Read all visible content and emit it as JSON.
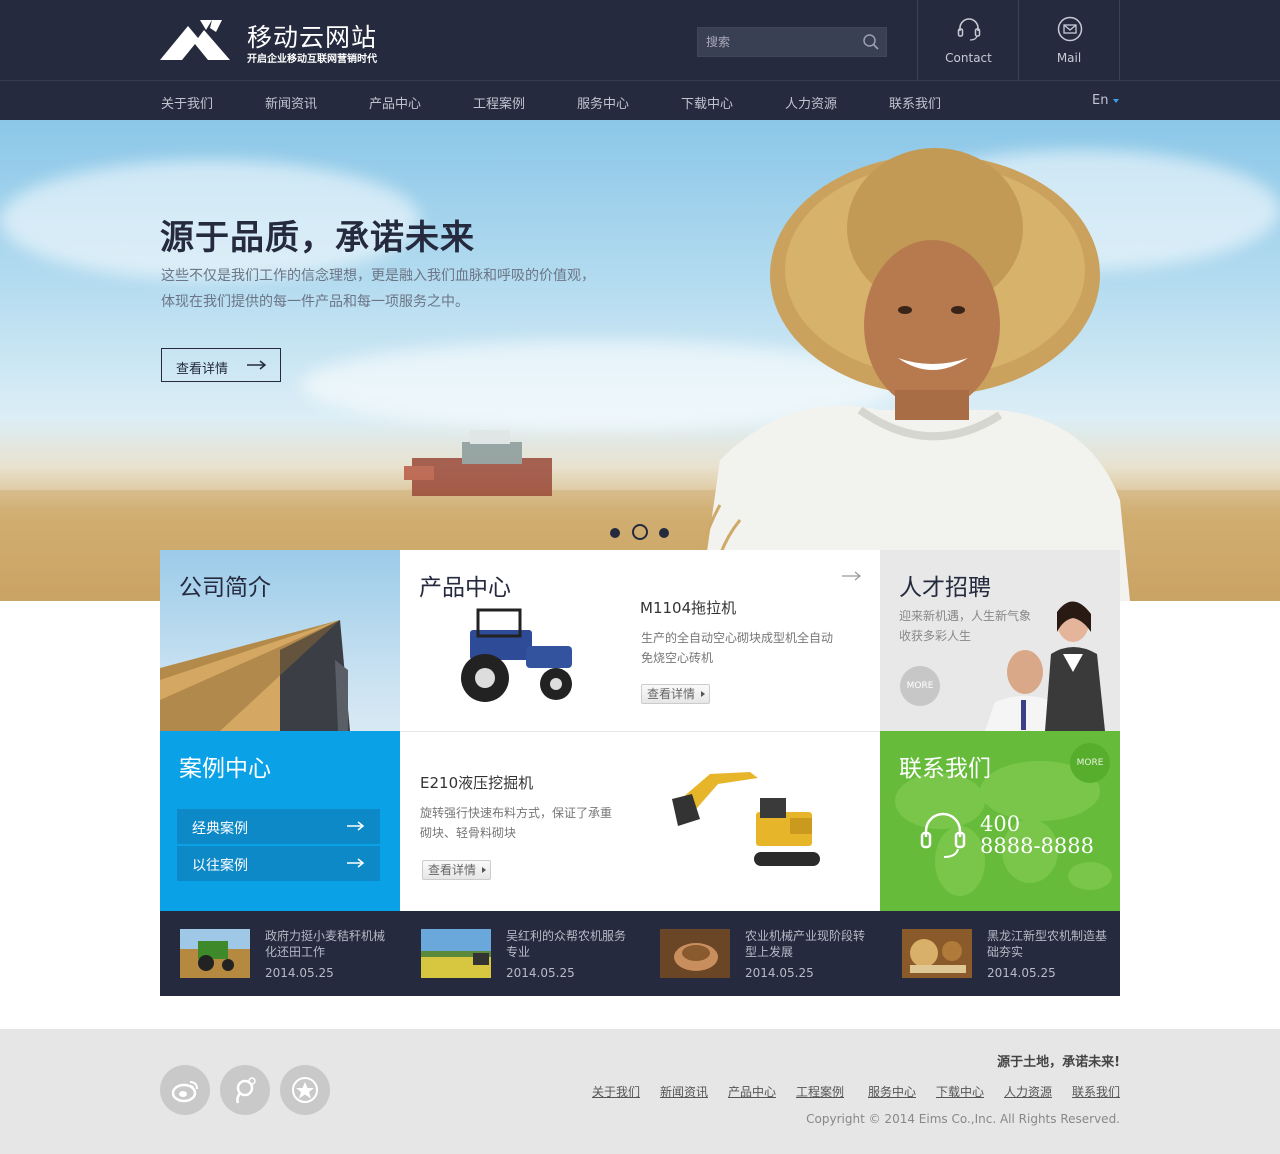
{
  "header": {
    "site_title": "移动云网站",
    "site_subtitle": "开启企业移动互联网营销时代",
    "search_placeholder": "搜索",
    "contact_label": "Contact",
    "mail_label": "Mail"
  },
  "nav": {
    "items": [
      "关于我们",
      "新闻资讯",
      "产品中心",
      "工程案例",
      "服务中心",
      "下载中心",
      "人力资源",
      "联系我们"
    ],
    "language": "En"
  },
  "hero": {
    "title": "源于品质，承诺未来",
    "desc_line1": "这些不仅是我们工作的信念理想，更是融入我们血脉和呼吸的价值观，",
    "desc_line2": "体现在我们提供的每一件产品和每一项服务之中。",
    "button_label": "查看详情",
    "slides_count": 3,
    "active_slide": 2
  },
  "company": {
    "title": "公司简介"
  },
  "products": {
    "title": "产品中心",
    "item1": {
      "name": "M1104拖拉机",
      "desc_line1": "生产的全自动空心砌块成型机全自动",
      "desc_line2": "免烧空心砖机",
      "button": "查看详情"
    },
    "item2": {
      "name": "E210液压挖掘机",
      "desc_line1": "旋转强行快速布料方式，保证了承重",
      "desc_line2": "砌块、轻骨料砌块",
      "button": "查看详情"
    }
  },
  "recruit": {
    "title": "人才招聘",
    "desc_line1": "迎来新机遇，人生新气象",
    "desc_line2": "收获多彩人生",
    "more": "MORE"
  },
  "cases": {
    "title": "案例中心",
    "items": [
      "经典案例",
      "以往案例"
    ]
  },
  "contact": {
    "title": "联系我们",
    "more": "MORE",
    "phone_line1": "400",
    "phone_line2": "8888-8888"
  },
  "news": [
    {
      "title": "政府力挺小麦秸秆机械化还田工作",
      "date": "2014.05.25"
    },
    {
      "title": "吴红利的众帮农机服务专业",
      "date": "2014.05.25"
    },
    {
      "title": "农业机械产业现阶段转型上发展",
      "date": "2014.05.25"
    },
    {
      "title": "黑龙江新型农机制造基础夯实",
      "date": "2014.05.25"
    }
  ],
  "footer": {
    "slogan": "源于土地，承诺未来!",
    "links": [
      "关于我们",
      "新闻资讯",
      "产品中心",
      "工程案例",
      "服务中心",
      "下载中心",
      "人力资源",
      "联系我们"
    ],
    "copyright": "Copyright © 2014  Eims Co.,Inc. All Rights Reserved.",
    "social_icons": [
      "weibo-icon",
      "tencent-weibo-icon",
      "star-icon"
    ]
  },
  "colors": {
    "header_bg": "#252a3e",
    "cases_blue": "#0aa1e6",
    "contact_green": "#66bb3a",
    "footer_bg": "#e6e6e6"
  }
}
